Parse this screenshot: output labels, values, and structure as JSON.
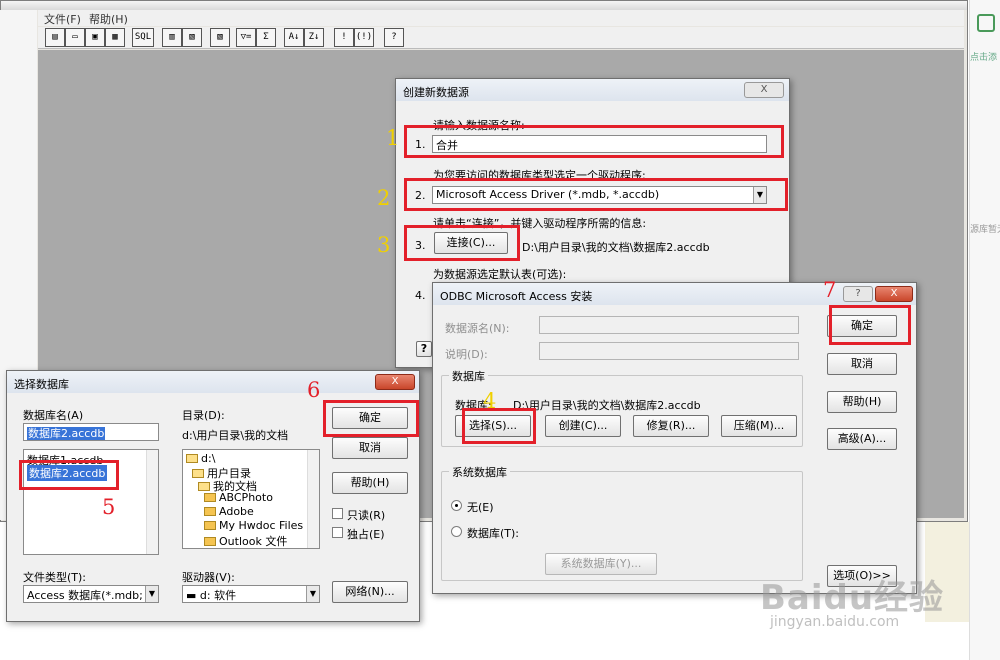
{
  "app": {
    "menu": [
      "文件(F)",
      "帮助(H)"
    ],
    "toolbar_buttons": [
      "new-icon",
      "open-icon",
      "save-icon",
      "import-icon",
      "sql-icon",
      "query-icon",
      "design-icon",
      "filter-icon",
      "sum-icon",
      "sort-asc-icon",
      "sort-desc-icon",
      "exclaim-icon",
      "run-icon",
      "help-icon"
    ],
    "toolbar_glyphs": [
      "▤",
      "▭",
      "▣",
      "▦",
      "SQL",
      "▥",
      "▧",
      "▽=",
      "Σ",
      "A↓",
      "Z↓",
      "!",
      "(!)",
      "?"
    ]
  },
  "right_panel": {
    "line1": "点击添",
    "line2": "源库暂无"
  },
  "create_ds": {
    "title": "创建新数据源",
    "close": "X",
    "step1_label": "请输入数据源名称:",
    "step1_num": "1.",
    "step1_value": "合并",
    "step2_label": "为您要访问的数据库类型选定一个驱动程序:",
    "step2_num": "2.",
    "step2_value": "Microsoft Access Driver (*.mdb, *.accdb)",
    "step3_label": "请单击“连接”，并键入驱动程序所需的信息:",
    "step3_num": "3.",
    "connect_btn": "连接(C)...",
    "connect_path": "D:\\用户目录\\我的文档\\数据库2.accdb",
    "step4_label": "为数据源选定默认表(可选):",
    "step4_num": "4.",
    "help_glyph": "?"
  },
  "odbc": {
    "title": "ODBC Microsoft Access 安装",
    "help_btn": "?",
    "close": "X",
    "dsn_label": "数据源名(N):",
    "desc_label": "说明(D):",
    "ok": "确定",
    "cancel": "取消",
    "help": "帮助(H)",
    "advanced": "高级(A)...",
    "options": "选项(O)>>",
    "db_group": "数据库",
    "db_label": "数据库:",
    "db_path": "D:\\用户目录\\我的文档\\数据库2.accdb",
    "select": "选择(S)...",
    "create": "创建(C)...",
    "repair": "修复(R)...",
    "compact": "压缩(M)...",
    "sysdb_group": "系统数据库",
    "radio_none": "无(E)",
    "radio_db": "数据库(T):",
    "sysdb_btn": "系统数据库(Y)..."
  },
  "select_db": {
    "title": "选择数据库",
    "close": "X",
    "dbname_label": "数据库名(A)",
    "dbname_value": "数据库2.accdb",
    "files": [
      "数据库1.accdb",
      "数据库2.accdb"
    ],
    "dir_label": "目录(D):",
    "dir_value": "d:\\用户目录\\我的文档",
    "folders": [
      "d:\\",
      "用户目录",
      "我的文档",
      "ABCPhoto",
      "Adobe",
      "My Hwdoc Files",
      "Outlook 文件"
    ],
    "ok": "确定",
    "cancel": "取消",
    "help": "帮助(H)",
    "readonly": "只读(R)",
    "exclusive": "独占(E)",
    "filetype_label": "文件类型(T):",
    "filetype_value": "Access 数据库(*.mdb; *.",
    "drive_label": "驱动器(V):",
    "drive_value": "d: 软件",
    "network": "网络(N)..."
  },
  "annotations": {
    "n1": "1",
    "n2": "2",
    "n3": "3",
    "n4": "4",
    "n5": "5",
    "n6": "6",
    "n7": "7",
    "yellow": "#f0d000",
    "red": "#e3202a"
  },
  "watermark": {
    "main": "Baidu经验",
    "sub": "jingyan.baidu.com"
  }
}
